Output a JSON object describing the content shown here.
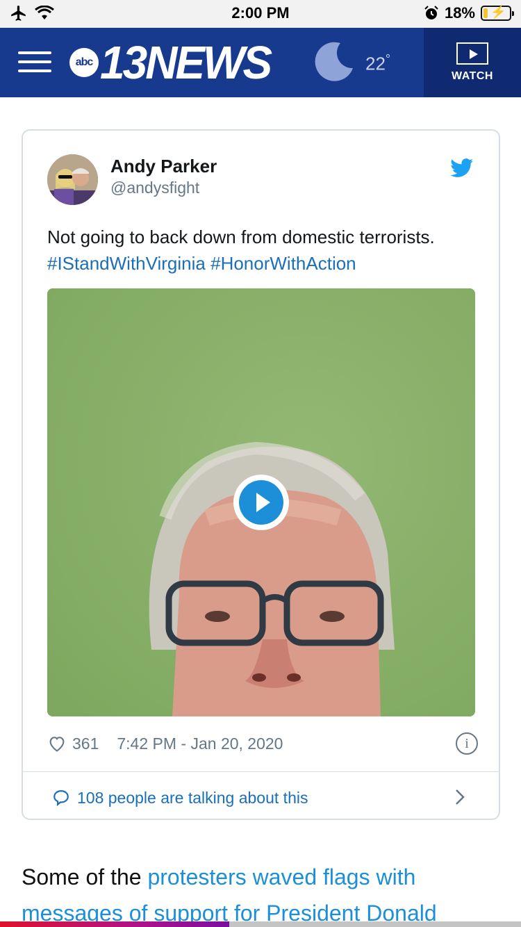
{
  "status_bar": {
    "time": "2:00 PM",
    "battery": "18%",
    "battery_level": 0.18
  },
  "header": {
    "logo_abc": "abc",
    "logo_text": "13NEWS",
    "temperature": "22",
    "degree": "°",
    "watch_label": "WATCH"
  },
  "tweet": {
    "author_name": "Andy Parker",
    "author_handle": "@andysfight",
    "text": "Not going to back down from domestic terrorists.",
    "hashtag_1": "#IStandWithVirginia",
    "hashtag_2": "#HonorWithAction",
    "likes": "361",
    "timestamp": "7:42 PM - Jan 20, 2020",
    "talking": "108 people are talking about this",
    "info_glyph": "i"
  },
  "article": {
    "line1_plain": "Some of the ",
    "line1_link": "protesters waved flags with",
    "line2": "messages of support for President Donald"
  },
  "reading_progress": 0.44,
  "colors": {
    "header_bg": "#173a8f",
    "watch_bg": "#0f2a70",
    "link": "#1d8fd8",
    "twitter_blue": "#1da1f2"
  }
}
